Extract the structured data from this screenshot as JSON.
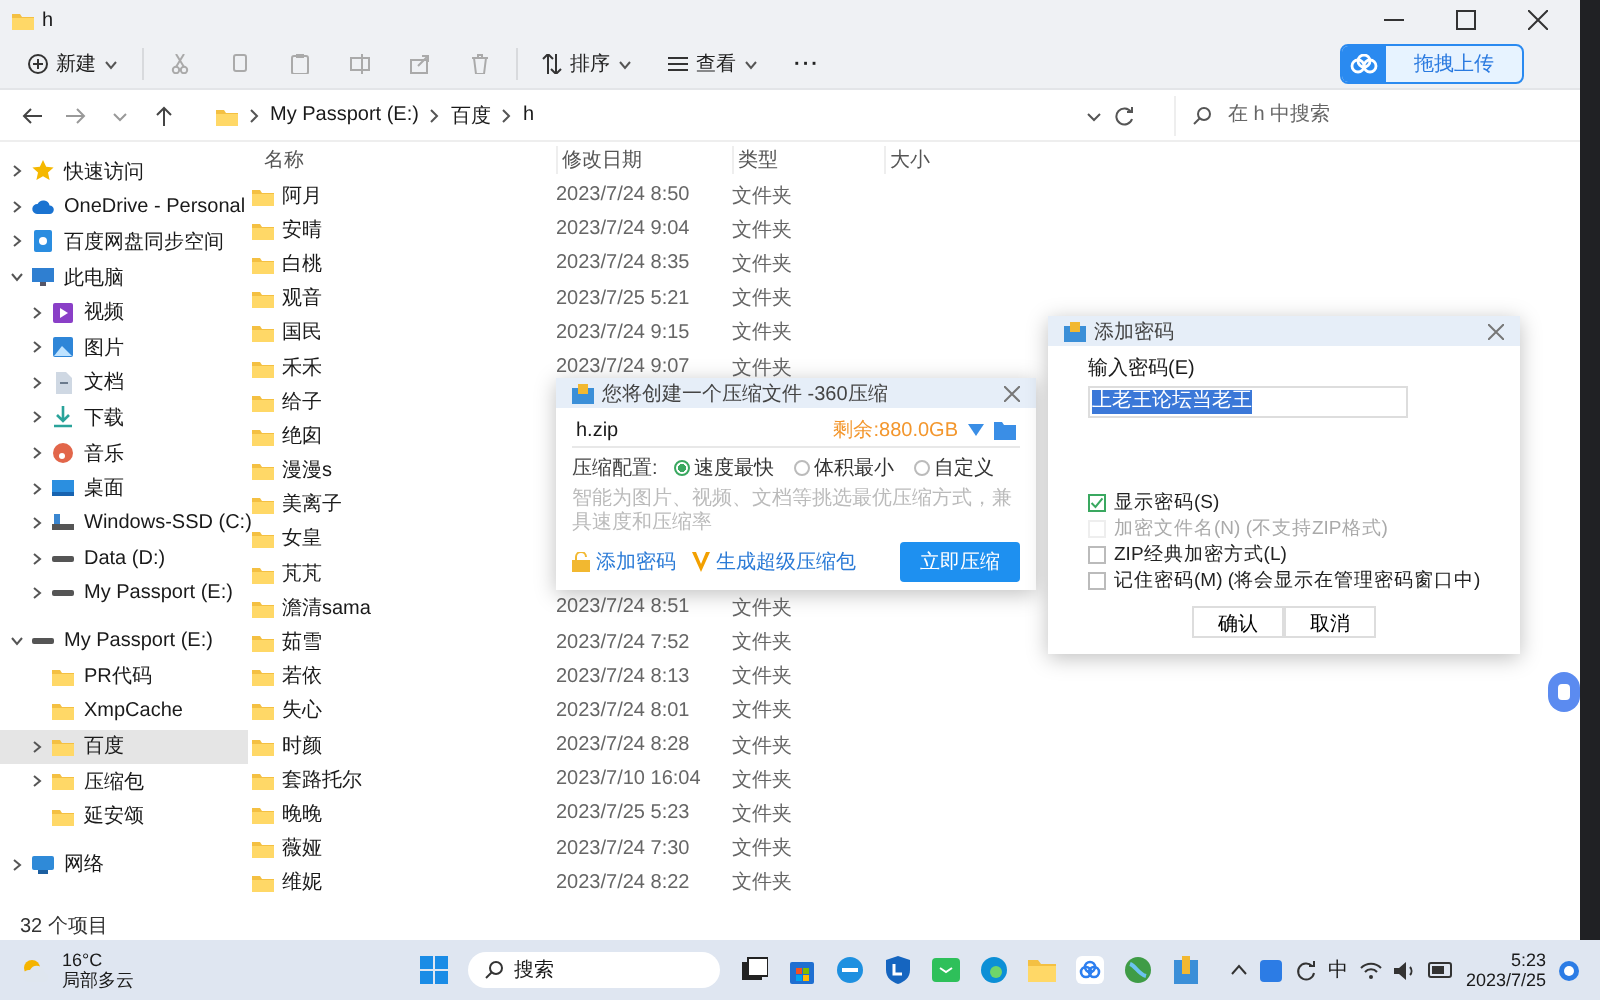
{
  "window": {
    "title": "h"
  },
  "toolbar": {
    "new": "新建",
    "sort": "排序",
    "view": "查看",
    "more": "···",
    "upload": "拖拽上传"
  },
  "address": {
    "path": [
      "My Passport (E:)",
      "百度",
      "h"
    ],
    "search_placeholder": "在 h 中搜索"
  },
  "sidebar": {
    "items": [
      {
        "label": "快速访问",
        "kind": "quick",
        "expanded": false,
        "selected": false
      },
      {
        "label": "OneDrive - Personal",
        "kind": "cloud",
        "expanded": false,
        "selected": false
      },
      {
        "label": "百度网盘同步空间",
        "kind": "sync",
        "expanded": false,
        "selected": false
      },
      {
        "label": "此电脑",
        "kind": "pc",
        "expanded": true,
        "selected": false,
        "children": [
          {
            "label": "视频",
            "kind": "video",
            "expanded": false,
            "selected": false
          },
          {
            "label": "图片",
            "kind": "image",
            "expanded": false,
            "selected": false
          },
          {
            "label": "文档",
            "kind": "doc",
            "expanded": false,
            "selected": false
          },
          {
            "label": "下载",
            "kind": "download",
            "expanded": false,
            "selected": false
          },
          {
            "label": "音乐",
            "kind": "music",
            "expanded": false,
            "selected": false
          },
          {
            "label": "桌面",
            "kind": "desktop",
            "expanded": false,
            "selected": false
          },
          {
            "label": "Windows-SSD (C:)",
            "kind": "system",
            "expanded": false,
            "selected": false
          },
          {
            "label": "Data (D:)",
            "kind": "drive",
            "expanded": false,
            "selected": false
          },
          {
            "label": "My Passport (E:)",
            "kind": "drive",
            "expanded": false,
            "selected": false
          }
        ]
      },
      {
        "label": "My Passport (E:)",
        "kind": "drive",
        "expanded": true,
        "selected": false,
        "children": [
          {
            "label": "PR代码",
            "kind": "folder",
            "selected": false
          },
          {
            "label": "XmpCache",
            "kind": "folder",
            "selected": false
          },
          {
            "label": "百度",
            "kind": "folder",
            "expanded": false,
            "selected": true
          },
          {
            "label": "压缩包",
            "kind": "folder",
            "expanded": false,
            "selected": false
          },
          {
            "label": "延安颂",
            "kind": "folder",
            "selected": false
          }
        ]
      },
      {
        "label": "网络",
        "kind": "network",
        "expanded": false,
        "selected": false
      }
    ]
  },
  "table": {
    "columns": [
      "名称",
      "修改日期",
      "类型",
      "大小"
    ],
    "rows": [
      {
        "name": "阿月",
        "modified": "2023/7/24 8:50",
        "type": "文件夹"
      },
      {
        "name": "安晴",
        "modified": "2023/7/24 9:04",
        "type": "文件夹"
      },
      {
        "name": "白桃",
        "modified": "2023/7/24 8:35",
        "type": "文件夹"
      },
      {
        "name": "观音",
        "modified": "2023/7/25 5:21",
        "type": "文件夹"
      },
      {
        "name": "国民",
        "modified": "2023/7/24 9:15",
        "type": "文件夹"
      },
      {
        "name": "禾禾",
        "modified": "2023/7/24 9:07",
        "type": "文件夹"
      },
      {
        "name": "给子"
      },
      {
        "name": "绝囱"
      },
      {
        "name": "漫漫s"
      },
      {
        "name": "美离子"
      },
      {
        "name": "女皇"
      },
      {
        "name": "芃芃"
      },
      {
        "name": "澹清sama",
        "modified": "2023/7/24 8:51",
        "type": "文件夹"
      },
      {
        "name": "茹雪",
        "modified": "2023/7/24 7:52",
        "type": "文件夹"
      },
      {
        "name": "若依",
        "modified": "2023/7/24 8:13",
        "type": "文件夹"
      },
      {
        "name": "失心",
        "modified": "2023/7/24 8:01",
        "type": "文件夹"
      },
      {
        "name": "时颜",
        "modified": "2023/7/24 8:28",
        "type": "文件夹"
      },
      {
        "name": "套路托尔",
        "modified": "2023/7/10 16:04",
        "type": "文件夹"
      },
      {
        "name": "晚晚",
        "modified": "2023/7/25 5:23",
        "type": "文件夹"
      },
      {
        "name": "薇娅",
        "modified": "2023/7/24 7:30",
        "type": "文件夹"
      },
      {
        "name": "维妮",
        "modified": "2023/7/24 8:22",
        "type": "文件夹"
      }
    ]
  },
  "status_bar": "32 个项目",
  "compress_dialog": {
    "title": "您将创建一个压缩文件 -360压缩",
    "filename": "h.zip",
    "free_space": "剩余:880.0GB",
    "config_label": "压缩配置:",
    "options": [
      {
        "label": "速度最快",
        "selected": true
      },
      {
        "label": "体积最小",
        "selected": false
      },
      {
        "label": "自定义",
        "selected": false
      }
    ],
    "hint": "智能为图片、视频、文档等挑选最优压缩方式，兼具速度和压缩率",
    "add_password": "添加密码",
    "super_package": "生成超级压缩包",
    "start": "立即压缩"
  },
  "password_dialog": {
    "title": "添加密码",
    "field_label": "输入密码(E)",
    "value": "上老王论坛当老王",
    "options": [
      {
        "label": "显示密码(S)",
        "checked": true,
        "disabled": false
      },
      {
        "label": "加密文件名(N) (不支持ZIP格式)",
        "checked": false,
        "disabled": true
      },
      {
        "label": "ZIP经典加密方式(L)",
        "checked": false,
        "disabled": false
      },
      {
        "label": "记住密码(M) (将会显示在管理密码窗口中)",
        "checked": false,
        "disabled": false
      }
    ],
    "buttons": [
      "确认",
      "取消"
    ]
  },
  "taskbar": {
    "temperature": "16°C",
    "weather": "局部多云",
    "search": "搜索",
    "ime": "中",
    "time": "5:23",
    "date": "2023/7/25"
  }
}
